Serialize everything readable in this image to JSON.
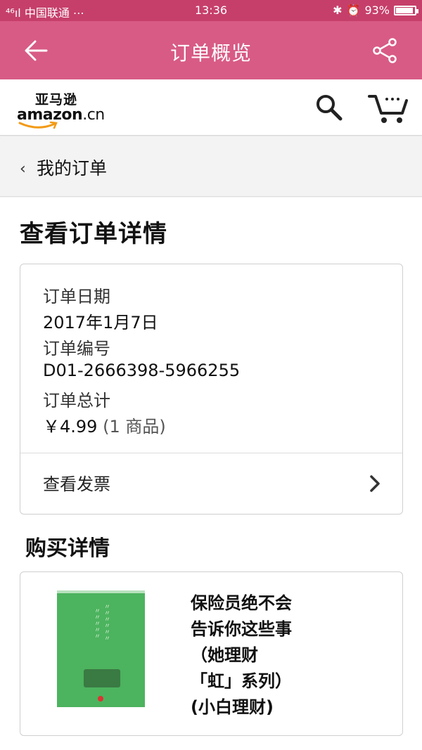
{
  "status_bar": {
    "carrier": "中国联通",
    "time": "13:36",
    "battery": "93%",
    "battery_level": 0.93
  },
  "app_bar": {
    "title": "订单概览",
    "icons": [
      "back-arrow-icon",
      "share-icon"
    ]
  },
  "amazon_header": {
    "logo_cn": "亚马逊",
    "logo_en": "amazon",
    "logo_suffix": ".cn",
    "icons": [
      "search-icon",
      "cart-icon"
    ]
  },
  "breadcrumb": {
    "label": "我的订单"
  },
  "page": {
    "title": "查看订单详情"
  },
  "order": {
    "date_label": "订单日期",
    "date_value": "2017年1月7日",
    "number_label": "订单编号",
    "number_value": "D01-2666398-5966255",
    "total_label": "订单总计",
    "total_value": "￥4.99",
    "total_items": "(1 商品)",
    "invoice_label": "查看发票"
  },
  "purchase": {
    "heading": "购买详情",
    "item": {
      "title_lines": [
        "保险员绝不会",
        "告诉你这些事",
        "（她理财",
        "「虹」系列）",
        "(小白理财)"
      ]
    }
  },
  "colors": {
    "status_bar": "#c63f6b",
    "app_bar": "#d85b85",
    "cover": "#4cb35e"
  }
}
